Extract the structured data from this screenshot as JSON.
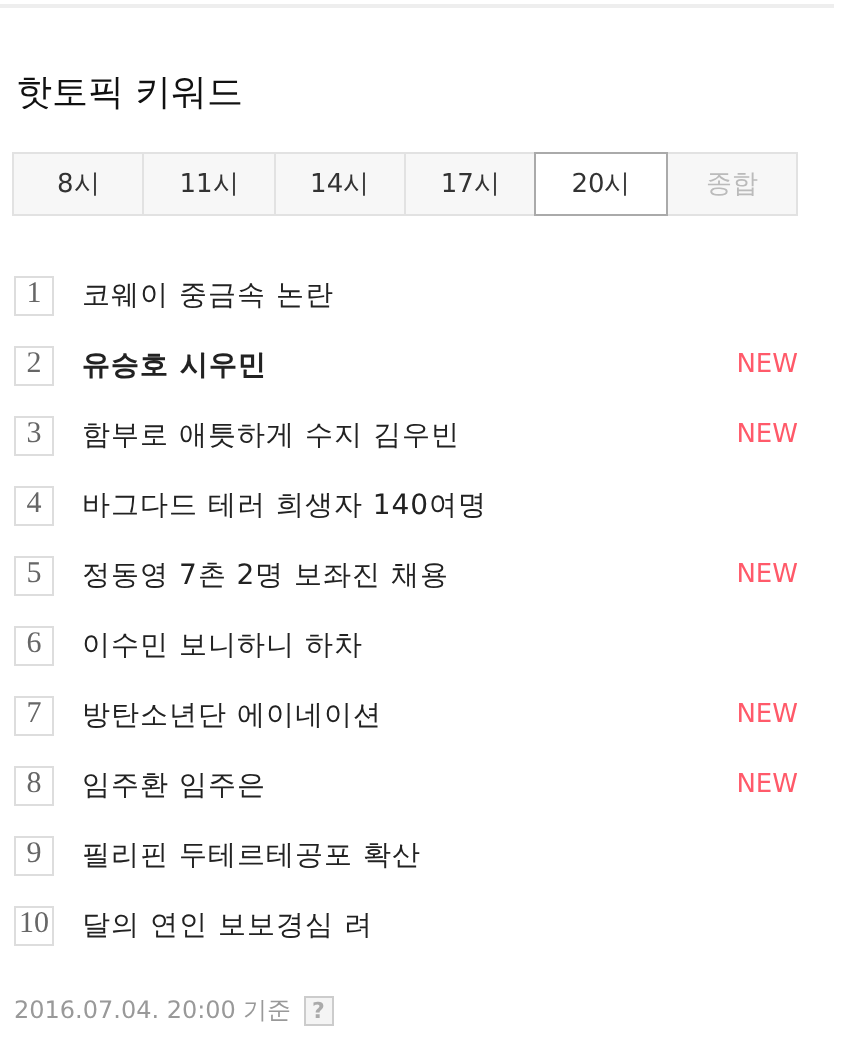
{
  "title": "핫토픽 키워드",
  "tabs": [
    {
      "label": "8시",
      "selected": false,
      "disabled": false
    },
    {
      "label": "11시",
      "selected": false,
      "disabled": false
    },
    {
      "label": "14시",
      "selected": false,
      "disabled": false
    },
    {
      "label": "17시",
      "selected": false,
      "disabled": false
    },
    {
      "label": "20시",
      "selected": true,
      "disabled": false
    },
    {
      "label": "종합",
      "selected": false,
      "disabled": true
    }
  ],
  "keywords": [
    {
      "rank": "1",
      "text": "코웨이 중금속 논란",
      "bold": false
    },
    {
      "rank": "2",
      "text": "유승호 시우민",
      "bold": true,
      "badge": "NEW"
    },
    {
      "rank": "3",
      "text": "함부로 애틋하게 수지 김우빈",
      "bold": false,
      "badge": "NEW"
    },
    {
      "rank": "4",
      "text": "바그다드 테러 희생자 140여명",
      "bold": false
    },
    {
      "rank": "5",
      "text": "정동영 7촌 2명 보좌진 채용",
      "bold": false,
      "badge": "NEW"
    },
    {
      "rank": "6",
      "text": "이수민 보니하니 하차",
      "bold": false
    },
    {
      "rank": "7",
      "text": "방탄소년단 에이네이션",
      "bold": false,
      "badge": "NEW"
    },
    {
      "rank": "8",
      "text": "임주환 임주은",
      "bold": false,
      "badge": "NEW"
    },
    {
      "rank": "9",
      "text": "필리핀 두테르테공포 확산",
      "bold": false
    },
    {
      "rank": "10",
      "text": "달의 연인 보보경심 려",
      "bold": false
    }
  ],
  "footer": {
    "timestamp": "2016.07.04. 20:00 기준",
    "help": "?"
  }
}
